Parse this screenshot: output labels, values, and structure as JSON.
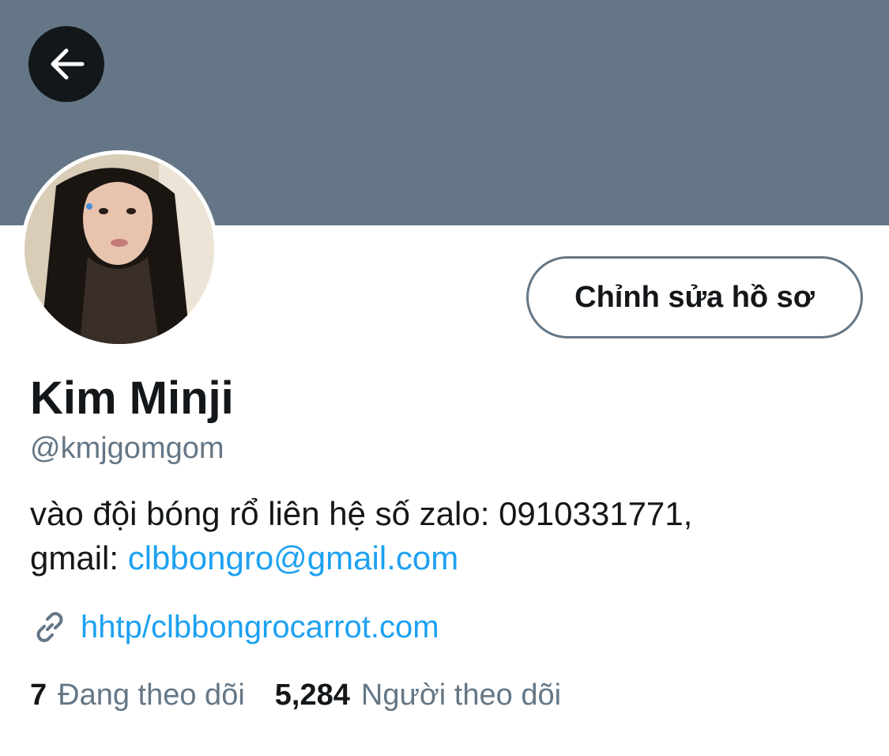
{
  "header": {
    "banner_color": "#657786",
    "back_icon": "arrow-left-icon"
  },
  "profile": {
    "avatar_icon": "profile-photo",
    "edit_button_label": "Chỉnh sửa hồ sơ",
    "display_name": "Kim Minji",
    "handle": "@kmjgomgom",
    "bio_text": "vào đội bóng rổ liên hệ số zalo: 0910331771,",
    "bio_line2_prefix": "gmail: ",
    "bio_email": "clbbongro@gmail.com",
    "website_icon": "link-icon",
    "website": "hhtp/clbbongrocarrot.com"
  },
  "stats": {
    "following_count": "7",
    "following_label": "Đang theo dõi",
    "followers_count": "5,284",
    "followers_label": "Người theo dõi"
  },
  "colors": {
    "accent": "#1da1f2",
    "text_primary": "#14171a",
    "text_secondary": "#657786"
  }
}
